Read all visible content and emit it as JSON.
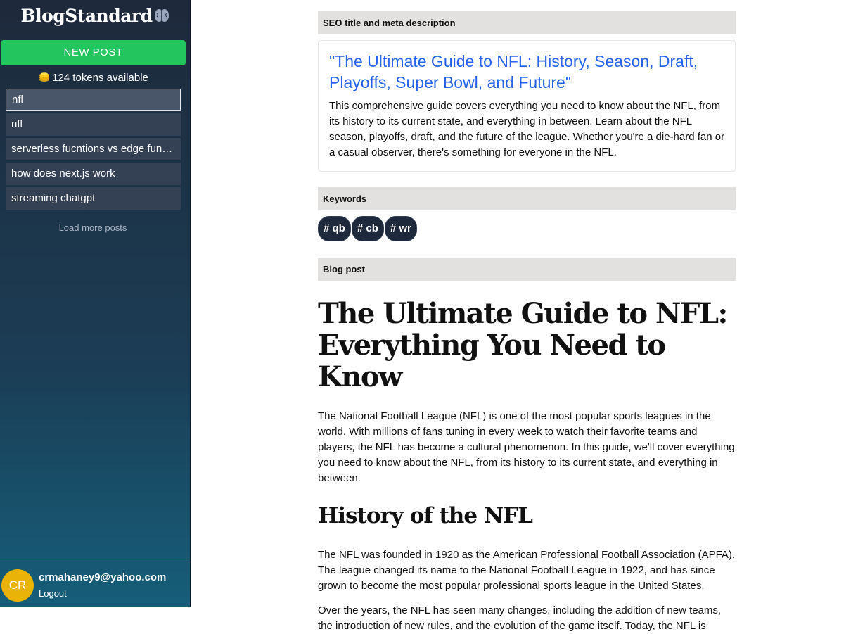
{
  "sidebar": {
    "brand": "BlogStandard",
    "new_post_label": "NEW POST",
    "tokens_text": "124 tokens available",
    "posts": [
      {
        "label": "nfl"
      },
      {
        "label": "nfl"
      },
      {
        "label": "serverless fucntions vs edge functions"
      },
      {
        "label": "how does next.js work"
      },
      {
        "label": "streaming chatgpt"
      }
    ],
    "load_more_label": "Load more posts",
    "user": {
      "initials": "CR",
      "email": "crmahaney9@yahoo.com",
      "logout_label": "Logout"
    }
  },
  "main": {
    "seo_section_label": "SEO title and meta description",
    "seo_title": "\"The Ultimate Guide to NFL: History, Season, Draft, Playoffs, Super Bowl, and Future\"",
    "seo_description": "This comprehensive guide covers everything you need to know about the NFL, from its history to its current state, and everything in between. Learn about the NFL season, playoffs, draft, and the future of the league. Whether you're a die-hard fan or a casual observer, there's something for everyone in the NFL.",
    "keywords_section_label": "Keywords",
    "keywords": [
      "qb",
      "cb",
      "wr"
    ],
    "blog_section_label": "Blog post",
    "blog": {
      "h1": "The Ultimate Guide to NFL: Everything You Need to Know",
      "intro": "The National Football League (NFL) is one of the most popular sports leagues in the world. With millions of fans tuning in every week to watch their favorite teams and players, the NFL has become a cultural phenomenon. In this guide, we'll cover everything you need to know about the NFL, from its history to its current state, and everything in between.",
      "h2_history": "History of the NFL",
      "history_p1": "The NFL was founded in 1920 as the American Professional Football Association (APFA). The league changed its name to the National Football League in 1922, and has since grown to become the most popular professional sports league in the United States.",
      "history_p2": "Over the years, the NFL has seen many changes, including the addition of new teams, the introduction of new rules, and the evolution of the game itself. Today, the NFL is"
    }
  },
  "colors": {
    "new_post_button": "#22c55e",
    "seo_title": "#2563eb",
    "avatar": "#eab308",
    "keyword_pill": "#1e293b"
  },
  "icons": {
    "brand": "brain-icon",
    "tokens": "coins-icon",
    "keyword": "hashtag-icon"
  }
}
